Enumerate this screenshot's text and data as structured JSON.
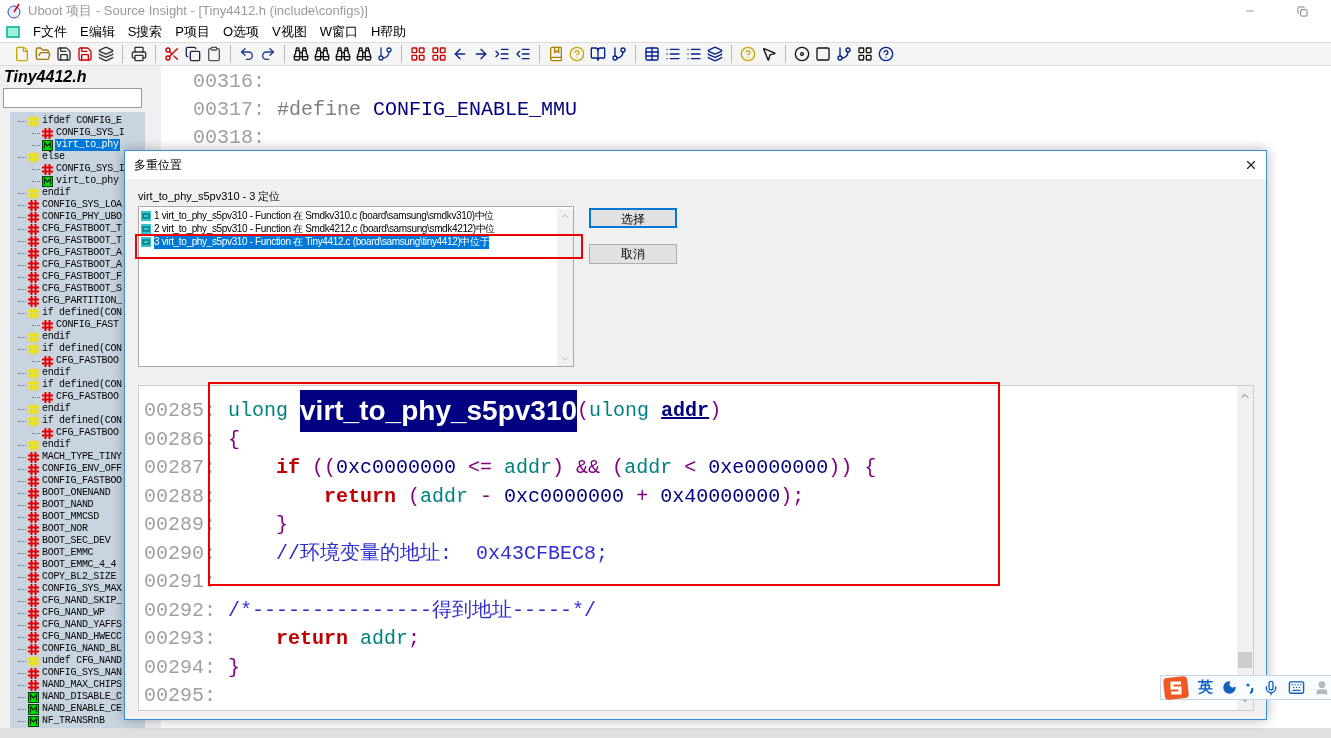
{
  "window": {
    "title": "Uboot 项目 - Source Insight - [Tiny4412.h (include\\configs)]"
  },
  "menu": [
    "F文件",
    "E编辑",
    "S搜索",
    "P项目",
    "O选项",
    "V视图",
    "W窗口",
    "H帮助"
  ],
  "outline": {
    "title": "Tiny4412.h",
    "items": [
      {
        "label": "ifdef CONFIG_E",
        "kind": "cond",
        "selected": false,
        "children": [
          {
            "label": "CONFIG_SYS_I",
            "kind": "define",
            "selected": false
          },
          {
            "label": "virt_to_phy",
            "kind": "macro",
            "selected": true
          }
        ]
      },
      {
        "label": "else",
        "kind": "cond",
        "selected": false,
        "children": [
          {
            "label": "CONFIG_SYS_I",
            "kind": "define",
            "selected": false
          },
          {
            "label": "virt_to_phy",
            "kind": "macro",
            "selected": false
          }
        ]
      },
      {
        "label": "endif",
        "kind": "cond",
        "selected": false
      },
      {
        "label": "CONFIG_SYS_LOA",
        "kind": "define",
        "selected": false
      },
      {
        "label": "CONFIG_PHY_UBO",
        "kind": "define",
        "selected": false
      },
      {
        "label": "CFG_FASTBOOT_T",
        "kind": "define",
        "selected": false
      },
      {
        "label": "CFG_FASTBOOT_T",
        "kind": "define",
        "selected": false
      },
      {
        "label": "CFG_FASTBOOT_A",
        "kind": "define",
        "selected": false
      },
      {
        "label": "CFG_FASTBOOT_A",
        "kind": "define",
        "selected": false
      },
      {
        "label": "CFG_FASTBOOT_F",
        "kind": "define",
        "selected": false
      },
      {
        "label": "CFG_FASTBOOT_S",
        "kind": "define",
        "selected": false
      },
      {
        "label": "CFG_PARTITION_",
        "kind": "define",
        "selected": false
      },
      {
        "label": "if defined(CON",
        "kind": "cond",
        "selected": false,
        "children": [
          {
            "label": "CONFIG_FAST",
            "kind": "define",
            "selected": false
          }
        ]
      },
      {
        "label": "endif",
        "kind": "cond",
        "selected": false
      },
      {
        "label": "if defined(CON",
        "kind": "cond",
        "selected": false,
        "children": [
          {
            "label": "CFG_FASTBOO",
            "kind": "define",
            "selected": false
          }
        ]
      },
      {
        "label": "endif",
        "kind": "cond",
        "selected": false
      },
      {
        "label": "if defined(CON",
        "kind": "cond",
        "selected": false,
        "children": [
          {
            "label": "CFG_FASTBOO",
            "kind": "define",
            "selected": false
          }
        ]
      },
      {
        "label": "endif",
        "kind": "cond",
        "selected": false
      },
      {
        "label": "if defined(CON",
        "kind": "cond",
        "selected": false,
        "children": [
          {
            "label": "CFG_FASTBOO",
            "kind": "define",
            "selected": false
          }
        ]
      },
      {
        "label": "endif",
        "kind": "cond",
        "selected": false
      },
      {
        "label": "MACH_TYPE_TINY",
        "kind": "define",
        "selected": false
      },
      {
        "label": "CONFIG_ENV_OFF",
        "kind": "define",
        "selected": false
      },
      {
        "label": "CONFIG_FASTBOO",
        "kind": "define",
        "selected": false
      },
      {
        "label": "BOOT_ONENAND",
        "kind": "define",
        "selected": false
      },
      {
        "label": "BOOT_NAND",
        "kind": "define",
        "selected": false
      },
      {
        "label": "BOOT_MMCSD",
        "kind": "define",
        "selected": false
      },
      {
        "label": "BOOT_NOR",
        "kind": "define",
        "selected": false
      },
      {
        "label": "BOOT_SEC_DEV",
        "kind": "define",
        "selected": false
      },
      {
        "label": "BOOT_EMMC",
        "kind": "define",
        "selected": false
      },
      {
        "label": "BOOT_EMMC_4_4",
        "kind": "define",
        "selected": false
      },
      {
        "label": "COPY_BL2_SIZE",
        "kind": "define",
        "selected": false
      },
      {
        "label": "CONFIG_SYS_MAX",
        "kind": "define",
        "selected": false
      },
      {
        "label": "CFG_NAND_SKIP_",
        "kind": "define",
        "selected": false
      },
      {
        "label": "CFG_NAND_WP",
        "kind": "define",
        "selected": false
      },
      {
        "label": "CFG_NAND_YAFFS",
        "kind": "define",
        "selected": false
      },
      {
        "label": "CFG_NAND_HWECC",
        "kind": "define",
        "selected": false
      },
      {
        "label": "CONFIG_NAND_BL",
        "kind": "define",
        "selected": false
      },
      {
        "label": "undef CFG_NAND",
        "kind": "cond",
        "selected": false
      },
      {
        "label": "CONFIG_SYS_NAN",
        "kind": "define",
        "selected": false
      },
      {
        "label": "NAND_MAX_CHIPS",
        "kind": "define",
        "selected": false
      },
      {
        "label": "NAND_DISABLE_C",
        "kind": "macro",
        "selected": false
      },
      {
        "label": "NAND_ENABLE_CE",
        "kind": "macro",
        "selected": false
      },
      {
        "label": "NF_TRANSRnB",
        "kind": "macro",
        "selected": false
      }
    ]
  },
  "editor": {
    "lines": [
      {
        "number": "00316:"
      },
      {
        "number": "00317:",
        "tokens": [
          {
            "text": "#define ",
            "kind": "directive"
          },
          {
            "text": "CONFIG_ENABLE_MMU",
            "kind": "macro"
          }
        ]
      },
      {
        "number": "00318:"
      }
    ]
  },
  "dialog": {
    "title": "多重位置",
    "caption": "virt_to_phy_s5pv310 - 3 定位",
    "locations": [
      {
        "text": "1 virt_to_phy_s5pv310 - Function 在 Smdkv310.c (board\\samsung\\smdkv310)中位",
        "selected": false
      },
      {
        "text": "2 virt_to_phy_s5pv310 - Function 在 Smdk4212.c (board\\samsung\\smdk4212)中位",
        "selected": false
      },
      {
        "text": "3 virt_to_phy_s5pv310 - Function 在 Tiny4412.c (board\\samsung\\tiny4412)中位于",
        "selected": true
      }
    ],
    "buttons": [
      {
        "label": "选择",
        "default": true
      },
      {
        "label": "取消",
        "default": false
      }
    ],
    "preview": [
      {
        "number": "00285:",
        "tokens": [
          {
            "text": "ulong ",
            "kind": "type"
          },
          {
            "text": "virt_to_phy_s5pv310",
            "kind": "highlight"
          },
          {
            "text": "(",
            "kind": "punct"
          },
          {
            "text": "ulong ",
            "kind": "type"
          },
          {
            "text": "addr",
            "kind": "param"
          },
          {
            "text": ")",
            "kind": "punct"
          }
        ]
      },
      {
        "number": "00286:",
        "tokens": [
          {
            "text": "{",
            "kind": "punct"
          }
        ]
      },
      {
        "number": "00287:",
        "tokens": [
          {
            "text": "    if",
            "kind": "keyword"
          },
          {
            "text": " ((",
            "kind": "punct"
          },
          {
            "text": "0xc0000000",
            "kind": "number"
          },
          {
            "text": " <= ",
            "kind": "punct"
          },
          {
            "text": "addr",
            "kind": "var"
          },
          {
            "text": ") && (",
            "kind": "punct"
          },
          {
            "text": "addr",
            "kind": "var"
          },
          {
            "text": " < ",
            "kind": "punct"
          },
          {
            "text": "0xe0000000",
            "kind": "number"
          },
          {
            "text": ")) {",
            "kind": "punct"
          }
        ]
      },
      {
        "number": "00288:",
        "tokens": [
          {
            "text": "        return",
            "kind": "keyword"
          },
          {
            "text": " (",
            "kind": "punct"
          },
          {
            "text": "addr",
            "kind": "var"
          },
          {
            "text": " - ",
            "kind": "punct"
          },
          {
            "text": "0xc0000000",
            "kind": "number"
          },
          {
            "text": " + ",
            "kind": "punct"
          },
          {
            "text": "0x40000000",
            "kind": "number"
          },
          {
            "text": ");",
            "kind": "punct"
          }
        ]
      },
      {
        "number": "00289:",
        "tokens": [
          {
            "text": "    }",
            "kind": "punct"
          }
        ]
      },
      {
        "number": "00290:",
        "tokens": [
          {
            "text": "    //环境变量的地址:  0x43CFBEC8;",
            "kind": "comment"
          }
        ]
      },
      {
        "number": "00291:"
      },
      {
        "number": "00292:",
        "tokens": [
          {
            "text": "/*---------------得到地址-----*/",
            "kind": "comment"
          }
        ]
      },
      {
        "number": "00293:",
        "tokens": [
          {
            "text": "    return ",
            "kind": "keyword"
          },
          {
            "text": "addr",
            "kind": "var"
          },
          {
            "text": ";",
            "kind": "punct"
          }
        ]
      },
      {
        "number": "00294:",
        "tokens": [
          {
            "text": "}",
            "kind": "punct"
          }
        ]
      },
      {
        "number": "00295:"
      }
    ]
  },
  "ime": {
    "mode": "英"
  }
}
